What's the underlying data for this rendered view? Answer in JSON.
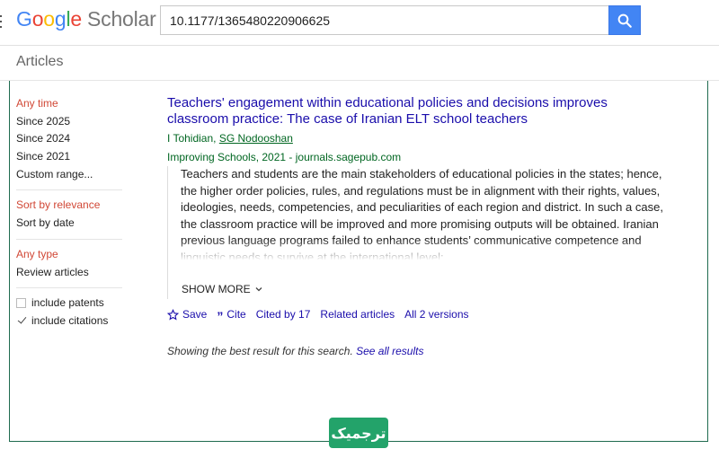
{
  "header": {
    "logo_letters": [
      {
        "ch": "G",
        "color": "#4285f4"
      },
      {
        "ch": "o",
        "color": "#ea4335"
      },
      {
        "ch": "o",
        "color": "#fbbc05"
      },
      {
        "ch": "g",
        "color": "#4285f4"
      },
      {
        "ch": "l",
        "color": "#34a853"
      },
      {
        "ch": "e",
        "color": "#ea4335"
      }
    ],
    "logo_suffix": "Scholar",
    "search_value": "10.1177/1365480220906625",
    "search_icon": "search-icon",
    "accent_color": "#4285f4"
  },
  "subheader": {
    "title": "Articles"
  },
  "sidebar": {
    "time": [
      "Any time",
      "Since 2025",
      "Since 2024",
      "Since 2021",
      "Custom range..."
    ],
    "sort": [
      "Sort by relevance",
      "Sort by date"
    ],
    "type": [
      "Any type",
      "Review articles"
    ],
    "checkboxes": [
      {
        "label": "include patents",
        "checked": false
      },
      {
        "label": "include citations",
        "checked": true
      }
    ],
    "active_color": "#d14836"
  },
  "result": {
    "title": "Teachers' engagement within educational policies and decisions improves classroom practice: The case of Iranian ELT school teachers",
    "author_1": "I Tohidian",
    "author_sep": ", ",
    "author_2": "SG Nodooshan",
    "venue": "Improving Schools, 2021 - journals.sagepub.com",
    "abstract": "Teachers and students are the main stakeholders of educational policies in the states; hence, the higher order policies, rules, and regulations must be in alignment with their rights, values, ideologies, needs, competencies, and peculiarities of each region and district. In such a case, the classroom practice will be improved and more promising outputs will be obtained. Iranian previous language programs failed to enhance students’ communicative competence and linguistic needs to survive at the international level;",
    "show_more": "SHOW MORE",
    "actions": {
      "save": "Save",
      "cite": "Cite",
      "cited_by": "Cited by 17",
      "related": "Related articles",
      "versions": "All 2 versions"
    },
    "link_color": "#1a0dab",
    "green_color": "#006621"
  },
  "note": {
    "text": "Showing the best result for this search. ",
    "link": "See all results"
  },
  "badge": {
    "text": "ترجمیک",
    "color": "#23a36a"
  }
}
